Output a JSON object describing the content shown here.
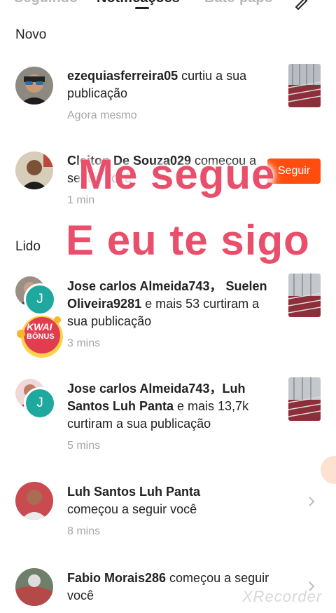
{
  "tabs": [
    {
      "label": "Seguindo",
      "active": false
    },
    {
      "label": "Notificações",
      "active": true
    },
    {
      "label": "Bate-papo",
      "active": false
    }
  ],
  "sections": {
    "new": "Novo",
    "read": "Lido"
  },
  "notifications": [
    {
      "bold": "ezequiasferreira05",
      "rest": " curtiu a sua publicação",
      "time": "Agora mesmo"
    },
    {
      "bold": "Cleiton De Souza029",
      "rest": " começou a seguir você",
      "time": "1 min",
      "button": "Seguir"
    },
    {
      "bold": "Jose carlos Almeida743， Suelen Oliveira9281",
      "rest": " e mais 53 curtiram a sua publicação",
      "time": "3 mins",
      "badge": "J"
    },
    {
      "bold": "Jose carlos Almeida743，Luh Santos Luh Panta",
      "rest": " e mais 13,7k curtiram a sua publicação",
      "time": "5 mins",
      "badge": "J"
    },
    {
      "bold": "Luh Santos Luh Panta",
      "rest": " começou a seguir você",
      "time": "8 mins"
    },
    {
      "bold": "Fabio Morais286",
      "rest": " começou a seguir você",
      "time": ""
    }
  ],
  "overlay": {
    "line1": "Me segue",
    "line2": "E eu te sigo",
    "color": "#e94f6b"
  },
  "kwai_bonus": {
    "line1": "KWAI",
    "line2": "BÔNUS"
  },
  "watermark": "XRecorder",
  "colors": {
    "accent": "#ff4d0f",
    "badge": "#1fa89d"
  }
}
